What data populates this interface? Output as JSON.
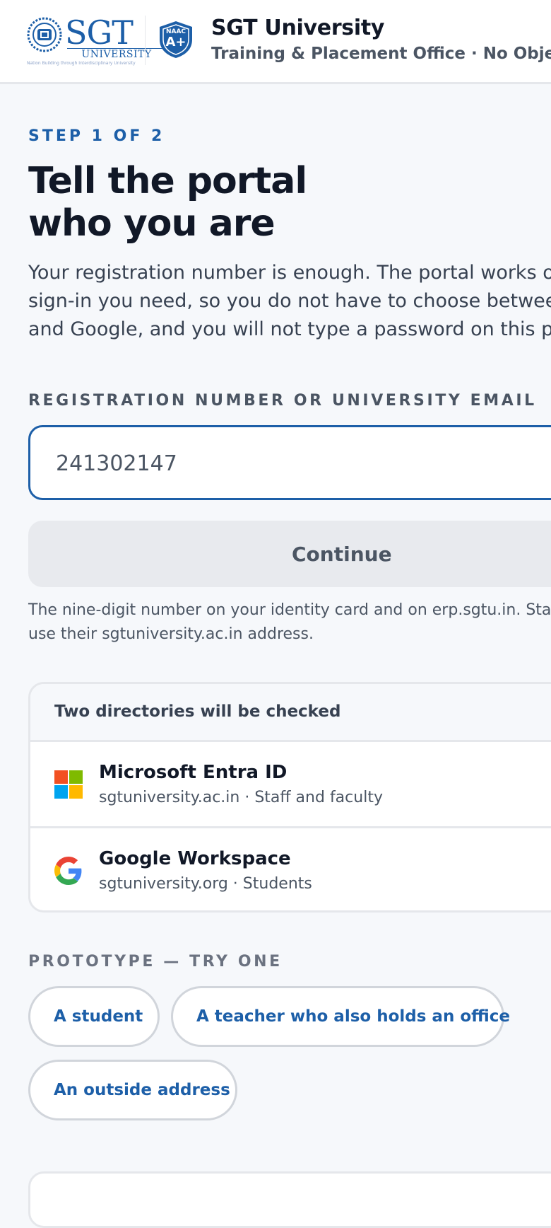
{
  "header": {
    "logo_word": "SGT",
    "logo_sub": "UNIVERSITY",
    "logo_tagline": "Nation Building through Interdisciplinary University",
    "naac_top": "NAAC",
    "naac_grade": "A+",
    "title": "SGT University",
    "subtitle": "Training & Placement Office · No Objection"
  },
  "step": {
    "label": "STEP 1 OF 2",
    "title_line1": "Tell the portal",
    "title_line2": "who you are",
    "intro_line1": "Your registration number is enough. The portal works out",
    "intro_line2": "sign-in you need, so you do not have to choose between",
    "intro_line3": "and Google, and you will not type a password on this pa"
  },
  "form": {
    "field_label": "REGISTRATION NUMBER OR UNIVERSITY EMAIL",
    "input_value": "241302147",
    "continue_label": "Continue",
    "hint_line1": "The nine-digit number on your identity card and on erp.sgtu.in. Sta",
    "hint_line2": "use their sgtuniversity.ac.in address."
  },
  "directories": {
    "heading": "Two directories will be checked",
    "items": [
      {
        "name": "Microsoft Entra ID",
        "meta": "sgtuniversity.ac.in · Staff and faculty",
        "icon": "microsoft-icon"
      },
      {
        "name": "Google Workspace",
        "meta": "sgtuniversity.org · Students",
        "icon": "google-icon"
      }
    ]
  },
  "prototype": {
    "label": "PROTOTYPE — TRY ONE",
    "options": [
      "A student",
      "A teacher who also holds an office",
      "An outside address"
    ]
  },
  "colors": {
    "accent": "#1d5fa8",
    "background": "#f6f8fb",
    "ms_red": "#f25022",
    "ms_green": "#7fba00",
    "ms_blue": "#00a4ef",
    "ms_yellow": "#ffb900"
  }
}
